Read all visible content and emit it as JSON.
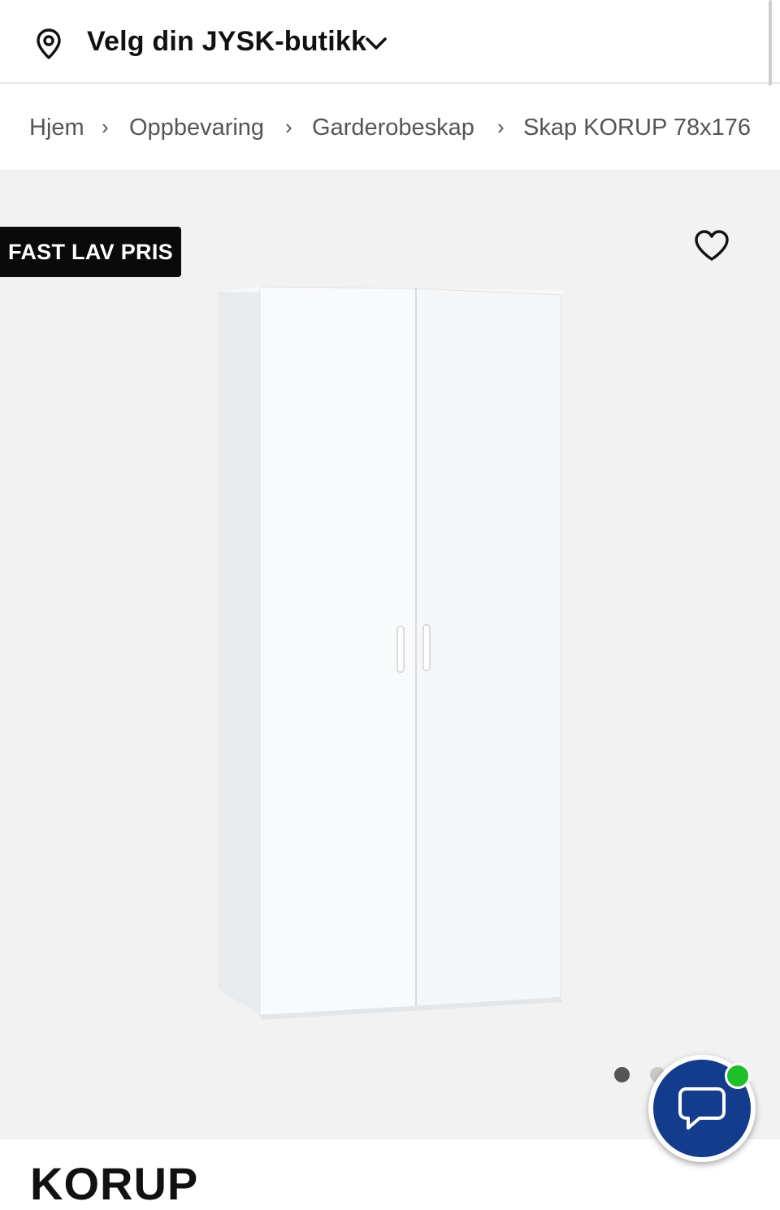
{
  "store_selector": {
    "label": "Velg din JYSK-butikk",
    "icon": "location-pin-icon",
    "dropdown_icon": "chevron-down-icon"
  },
  "breadcrumb": {
    "items": [
      "Hjem",
      "Oppbevaring",
      "Garderobeskap",
      "Skap KORUP 78x176"
    ],
    "separator": "›"
  },
  "gallery": {
    "badge": "FAST LAV PRIS",
    "favorite_icon": "heart-outline-icon",
    "image_alt": "white two-door wardrobe",
    "dots": {
      "count": 2,
      "active_index": 0
    }
  },
  "chat": {
    "icon": "chat-bubble-icon",
    "status": "online",
    "colors": {
      "button": "#143c8c",
      "status": "#1fbf2a"
    }
  },
  "product": {
    "title": "KORUP"
  },
  "colors": {
    "badge_bg": "#0a0a0a",
    "gallery_bg": "#f2f2f2",
    "text": "#111111",
    "breadcrumb_text": "#555555"
  }
}
